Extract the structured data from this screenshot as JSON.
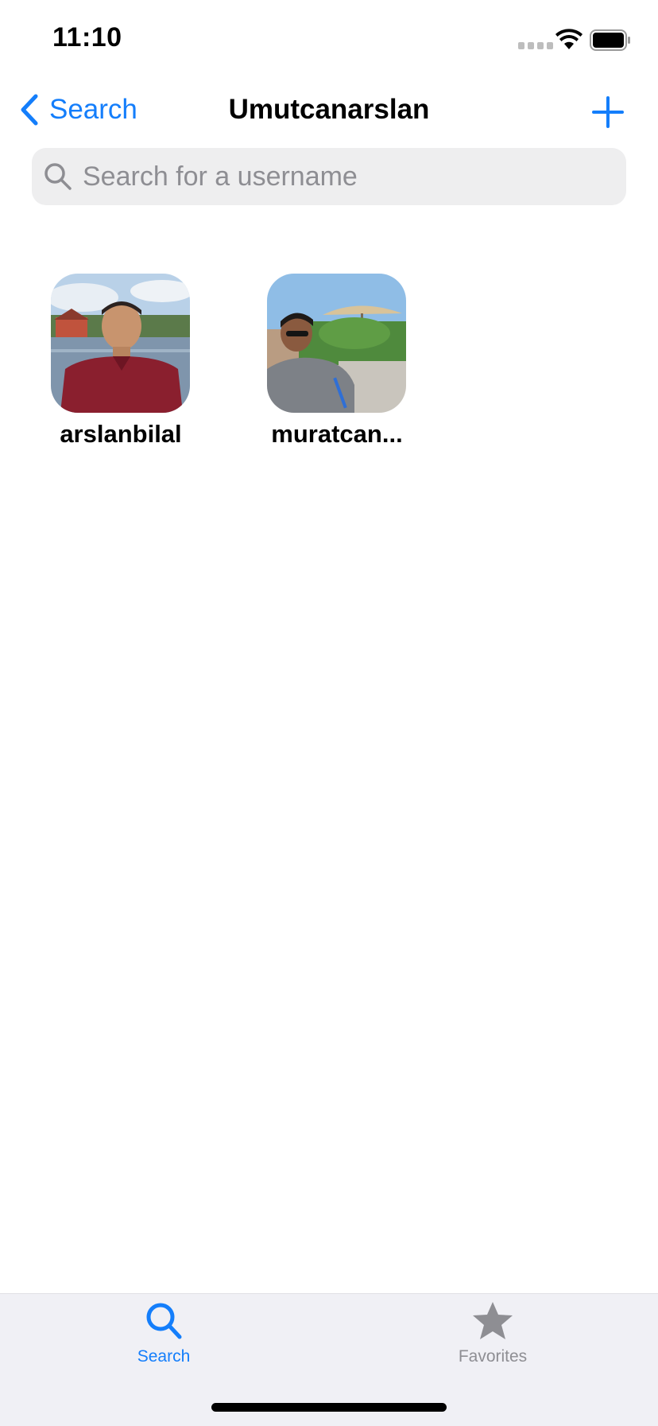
{
  "status_bar": {
    "time": "11:10"
  },
  "nav": {
    "back_label": "Search",
    "title": "Umutcanarslan",
    "add_icon": "plus-icon"
  },
  "search": {
    "placeholder": "Search for a username",
    "value": ""
  },
  "followers": [
    {
      "username": "arslanbilal",
      "avatar": "profile-photo"
    },
    {
      "username": "muratcan...",
      "avatar": "profile-photo"
    }
  ],
  "tab_bar": {
    "tabs": [
      {
        "label": "Search",
        "icon": "search-icon",
        "selected": true
      },
      {
        "label": "Favorites",
        "icon": "star-icon",
        "selected": false
      }
    ]
  },
  "colors": {
    "accent": "#147efb",
    "inactive": "#8e8e93",
    "search_bg": "#eeeeef",
    "tab_bar_bg": "#f0f0f5"
  }
}
